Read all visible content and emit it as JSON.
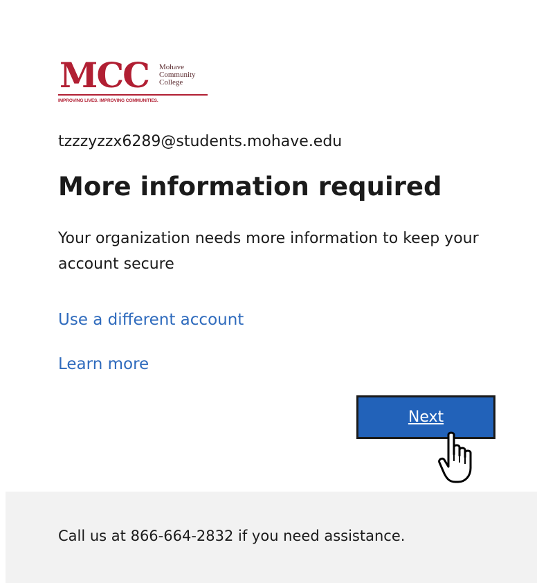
{
  "logo": {
    "mark": "MCC",
    "name_lines": [
      "Mohave",
      "Community",
      "College"
    ],
    "tagline": "IMPROVING LIVES. IMPROVING COMMUNITIES.",
    "brand_color": "#b11f33"
  },
  "account": {
    "email": "tzzzyzzx6289@students.mohave.edu"
  },
  "main": {
    "title": "More information required",
    "description": "Your organization needs more information to keep your account secure"
  },
  "links": {
    "different_account": "Use a different account",
    "learn_more": "Learn more",
    "color": "#2f6bbd"
  },
  "actions": {
    "next_label": "Next",
    "button_color": "#2262b9"
  },
  "cursor": {
    "icon": "hand-pointer-icon"
  },
  "footer": {
    "text": "Call us at 866-664-2832 if you need assistance."
  }
}
